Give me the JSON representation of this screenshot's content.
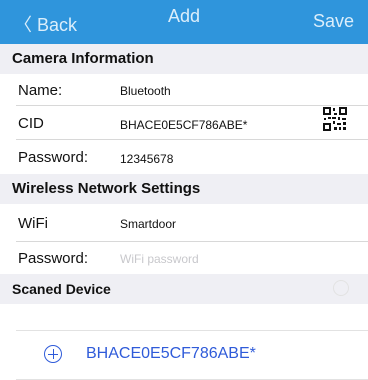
{
  "navbar": {
    "back_label": "〈 Back",
    "title": "Add",
    "save_label": "Save"
  },
  "camera_section": {
    "title": "Camera Information",
    "name_label": "Name:",
    "name_value": "Bluetooth",
    "cid_label": "CID",
    "cid_value": "BHACE0E5CF786ABE*",
    "password_label": "Password:",
    "password_value": "12345678"
  },
  "wireless_section": {
    "title": "Wireless Network Settings",
    "wifi_label": "WiFi",
    "wifi_value": "Smartdoor",
    "password_label": "Password:",
    "password_placeholder": "WiFi password"
  },
  "scanned_section": {
    "title": "Scaned Device",
    "devices": [
      "BHACE0E5CF786ABE*"
    ]
  },
  "colors": {
    "navbar": "#2f95dc",
    "section_bg": "#efeff4",
    "device_text": "#2f5bd9"
  },
  "icons": [
    "qr-code-icon",
    "add-circle-icon"
  ]
}
